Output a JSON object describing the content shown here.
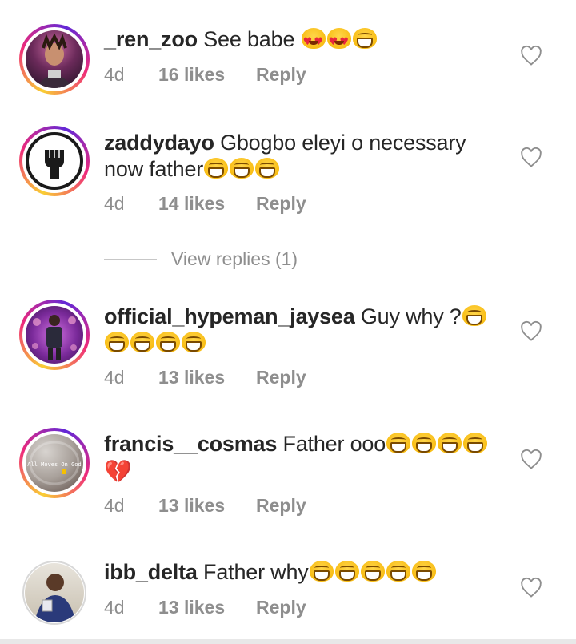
{
  "comments": [
    {
      "username": "_ren_zoo",
      "text": "See babe",
      "emojis": [
        "heart-eyes",
        "heart-eyes",
        "grin"
      ],
      "time": "4d",
      "likes": "16 likes",
      "reply": "Reply"
    },
    {
      "username": "zaddydayo",
      "text": "Gbogbo eleyi o necessary now father",
      "emojis": [
        "grin",
        "grin",
        "grin"
      ],
      "time": "4d",
      "likes": "14 likes",
      "reply": "Reply"
    },
    {
      "username": "official_hypeman_jaysea",
      "text": "Guy why ?",
      "emojis": [
        "grin",
        "grin",
        "grin",
        "grin",
        "grin"
      ],
      "time": "4d",
      "likes": "13 likes",
      "reply": "Reply"
    },
    {
      "username": "francis__cosmas",
      "text": "Father ooo",
      "emojis": [
        "grin",
        "grin",
        "grin",
        "grin",
        "broken-heart"
      ],
      "time": "4d",
      "likes": "13 likes",
      "reply": "Reply"
    },
    {
      "username": "ibb_delta",
      "text": "Father why",
      "emojis": [
        "grin",
        "grin",
        "grin",
        "grin",
        "grin"
      ],
      "time": "4d",
      "likes": "13 likes",
      "reply": "Reply"
    }
  ],
  "view_replies": "View replies (1)",
  "colors": {
    "text": "#262626",
    "muted": "#8e8e8e",
    "story_ring": "#ee2a7b"
  },
  "icons": {
    "like": "heart-outline-icon"
  },
  "avatar_text": {
    "francis__cosmas": "All Moves On God"
  }
}
